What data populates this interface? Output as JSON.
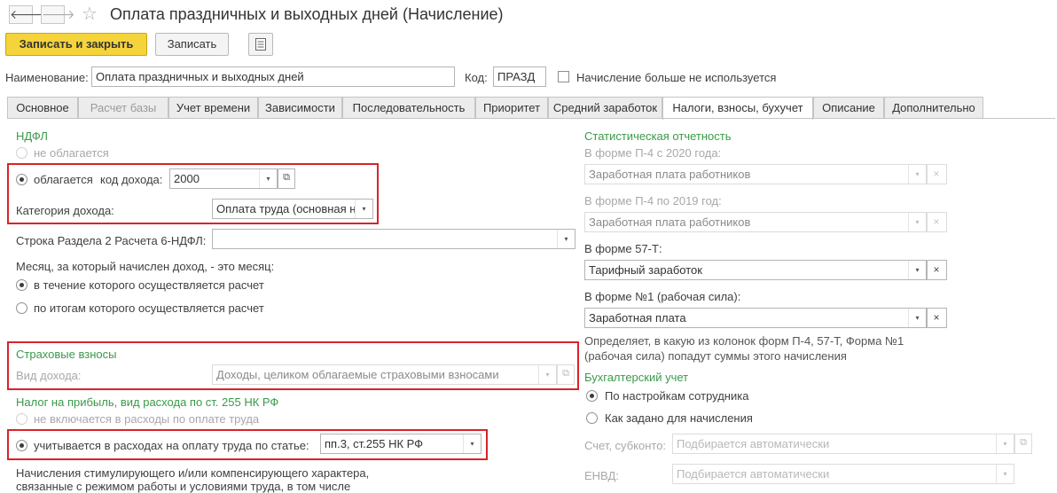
{
  "window": {
    "back_icon": "arrow-left-icon",
    "forward_icon": "arrow-right-icon",
    "favorite_icon": "star-icon",
    "title": "Оплата праздничных и выходных дней (Начисление)"
  },
  "toolbar": {
    "save_close_label": "Записать и закрыть",
    "save_label": "Записать",
    "report_icon": "document-list-icon"
  },
  "header": {
    "name_label": "Наименование:",
    "name_value": "Оплата праздничных и выходных дней",
    "code_label": "Код:",
    "code_value": "ПРАЗД",
    "unused_label": "Начисление больше не используется"
  },
  "tabs": [
    {
      "label": "Основное"
    },
    {
      "label": "Расчет базы"
    },
    {
      "label": "Учет времени"
    },
    {
      "label": "Зависимости"
    },
    {
      "label": "Последовательность"
    },
    {
      "label": "Приоритет"
    },
    {
      "label": "Средний заработок"
    },
    {
      "label": "Налоги, взносы, бухучет"
    },
    {
      "label": "Описание"
    },
    {
      "label": "Дополнительно"
    }
  ],
  "left": {
    "ndfl_header": "НДФЛ",
    "not_taxed": "не облагается",
    "taxed": "облагается",
    "income_code_label": "код дохода:",
    "income_code_value": "2000",
    "income_category_label": "Категория дохода:",
    "income_category_value": "Оплата труда (основная н",
    "section2_label": "Строка Раздела 2 Расчета 6-НДФЛ:",
    "section2_value": "",
    "month_label": "Месяц, за который начислен доход, - это месяц:",
    "month_opt1": "в течение которого осуществляется расчет",
    "month_opt2": "по итогам которого осуществляется расчет",
    "insurance_header": "Страховые взносы",
    "income_type_label": "Вид дохода:",
    "income_type_value": "Доходы, целиком облагаемые страховыми взносами",
    "profit_tax_header": "Налог на прибыль, вид расхода по ст. 255 НК РФ",
    "not_included": "не включается в расходы по оплате труда",
    "included": "учитывается в расходах на оплату труда по статье:",
    "article_value": "пп.3, ст.255 НК РФ",
    "stimulus_line1": "Начисления стимулирующего и/или компенсирующего характера,",
    "stimulus_line2": "связанные с режимом работы и условиями труда, в том числе"
  },
  "right": {
    "stat_header": "Статистическая отчетность",
    "p4_2020_label": "В форме П-4 с 2020 года:",
    "p4_2020_value": "Заработная плата работников",
    "p4_2019_label": "В форме П-4 по 2019 год:",
    "p4_2019_value": "Заработная плата работников",
    "f57_label": "В форме 57-Т:",
    "f57_value": "Тарифный заработок",
    "f1_label": "В форме №1 (рабочая сила):",
    "f1_value": "Заработная плата",
    "note_line1": "Определяет, в какую из колонок форм П-4, 57-Т, Форма №1",
    "note_line2": "(рабочая сила) попадут суммы этого начисления",
    "accounting_header": "Бухгалтерский учет",
    "acc_opt1": "По настройкам сотрудника",
    "acc_opt2": "Как задано для начисления",
    "account_label": "Счет, субконто:",
    "account_placeholder": "Подбирается автоматически",
    "envd_label": "ЕНВД:",
    "envd_placeholder": "Подбирается автоматически"
  },
  "icons": {
    "dropdown": "▾",
    "clear": "×",
    "open": "⧉"
  }
}
